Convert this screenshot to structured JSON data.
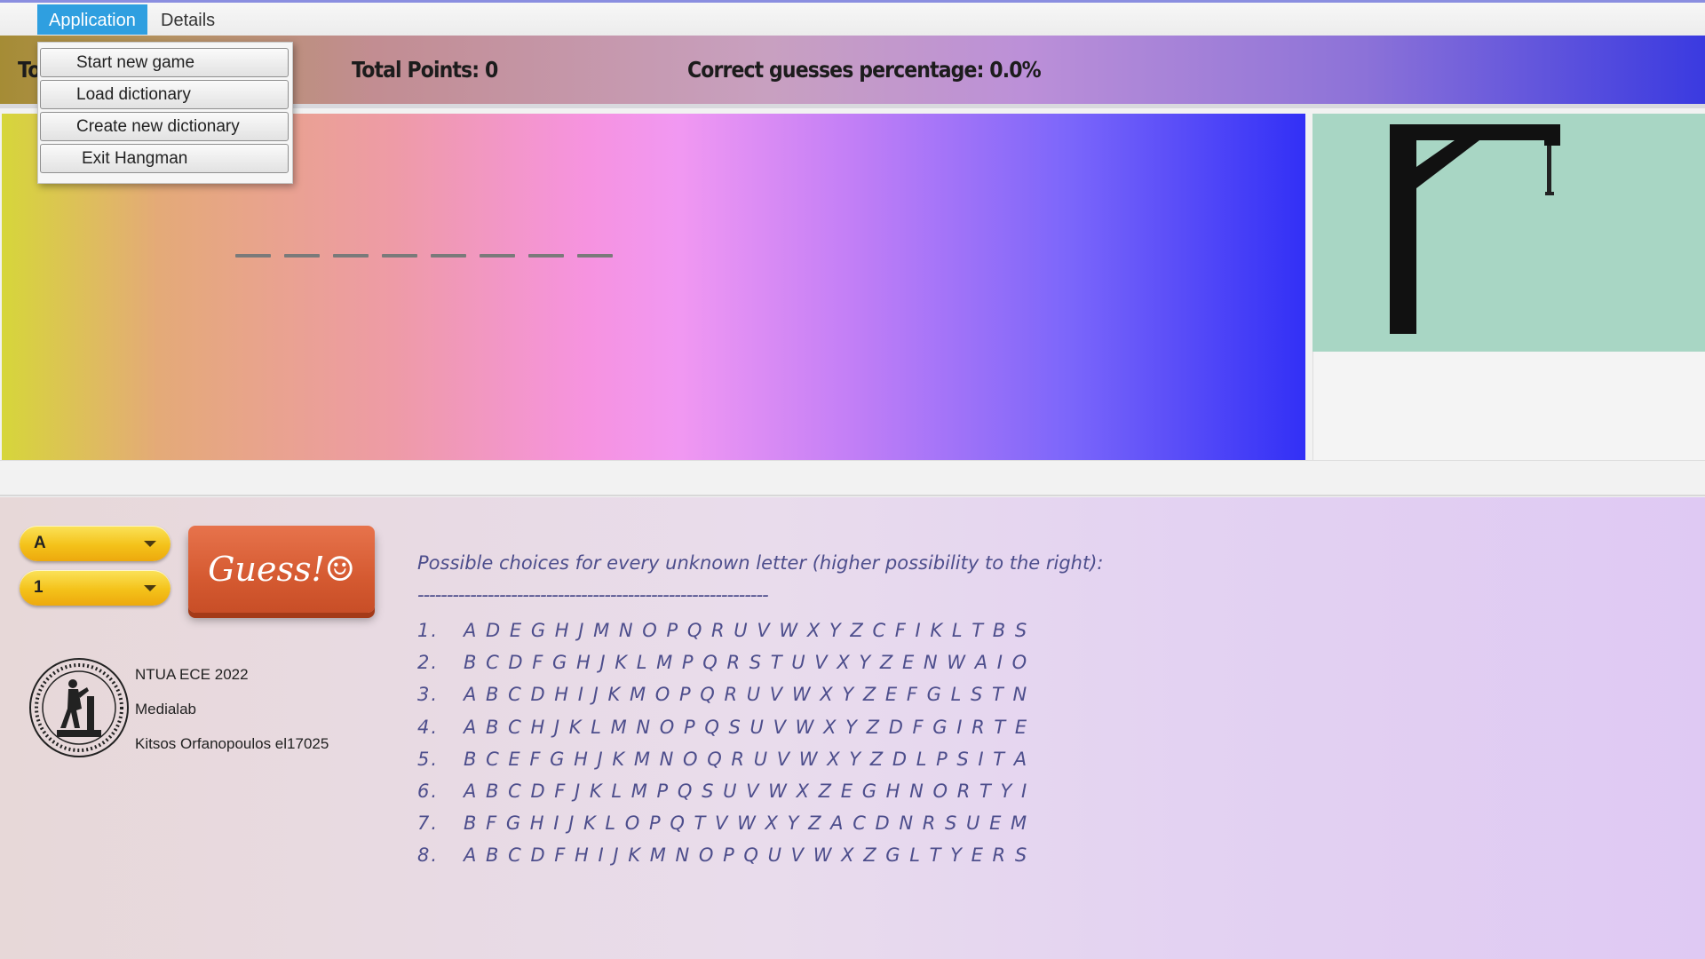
{
  "menubar": {
    "items": [
      "Application",
      "Details"
    ]
  },
  "app_menu": {
    "items": [
      "Start new game",
      "Load dictionary",
      "Create new dictionary",
      "Exit Hangman"
    ]
  },
  "stats": {
    "total_words": "To",
    "total_points": "Total Points:  0",
    "percentage": "Correct guesses percentage:  0.0%"
  },
  "word": {
    "length": 8
  },
  "controls": {
    "letter_value": "A",
    "position_value": "1",
    "guess_label": "Guess!☺"
  },
  "credits": {
    "line1": "NTUA ECE 2022",
    "line2": "Medialab",
    "line3": "Kitsos Orfanopoulos el17025"
  },
  "possibilities": {
    "title": "Possible choices for every unknown letter (higher possibility to the right):",
    "separator": "------------------------------------------------------------",
    "rows": [
      {
        "num": "1.",
        "letters": "A D E G H J M N O P Q R U V W X Y Z C F I K L T B S"
      },
      {
        "num": "2.",
        "letters": "B C D F G H J K L M P Q R S T U V X Y Z E N W A I O"
      },
      {
        "num": "3.",
        "letters": "A B C D H I J K M O P Q R U V W X Y Z E F G L S T N"
      },
      {
        "num": "4.",
        "letters": "A B C H J K L M N O P Q S U V W X Y Z D F G I R T E"
      },
      {
        "num": "5.",
        "letters": "B C E F G H J K M N O Q R U V W X Y Z D L P S I T A"
      },
      {
        "num": "6.",
        "letters": "A B C D F J K L M P Q S U V W X Z E G H N O R T Y I"
      },
      {
        "num": "7.",
        "letters": "B F G H I J K L O P Q T V W X Y Z A C D N R S U E M"
      },
      {
        "num": "8.",
        "letters": "A B C D F H I J K M N O P Q U V W X Z G L T Y E R S"
      }
    ]
  },
  "colors": {
    "menu_selected": "#2f9fe0",
    "guess_button": "#d55a31",
    "combo": "#f4c21a",
    "hangman_bg": "#a8d6c4",
    "possibilities_text": "#4d4e8c"
  },
  "icons": {
    "logo": "ntua-seal-icon",
    "combo_arrow": "chevron-down-icon",
    "gallows": "gallows-icon"
  }
}
